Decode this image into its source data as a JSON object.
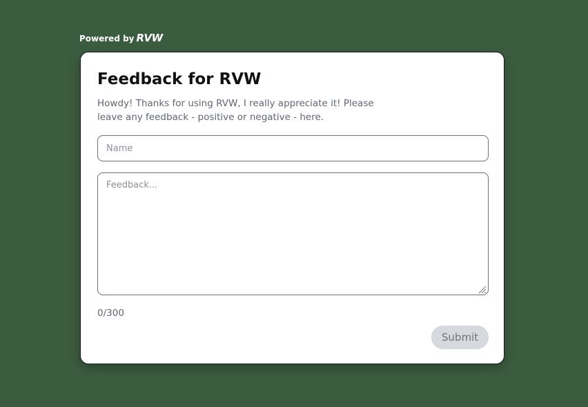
{
  "powered_by": {
    "prefix": "Powered by",
    "brand": "RVW"
  },
  "form": {
    "title": "Feedback for RVW",
    "description": "Howdy! Thanks for using RVW, I really appreciate it! Please leave any feedback - positive or negative - here.",
    "name_placeholder": "Name",
    "name_value": "",
    "feedback_placeholder": "Feedback...",
    "feedback_value": "",
    "char_counter": "0/300",
    "submit_label": "Submit"
  },
  "colors": {
    "background": "#3c5c40",
    "card": "#ffffff",
    "submit_disabled_bg": "#d6d9de"
  }
}
